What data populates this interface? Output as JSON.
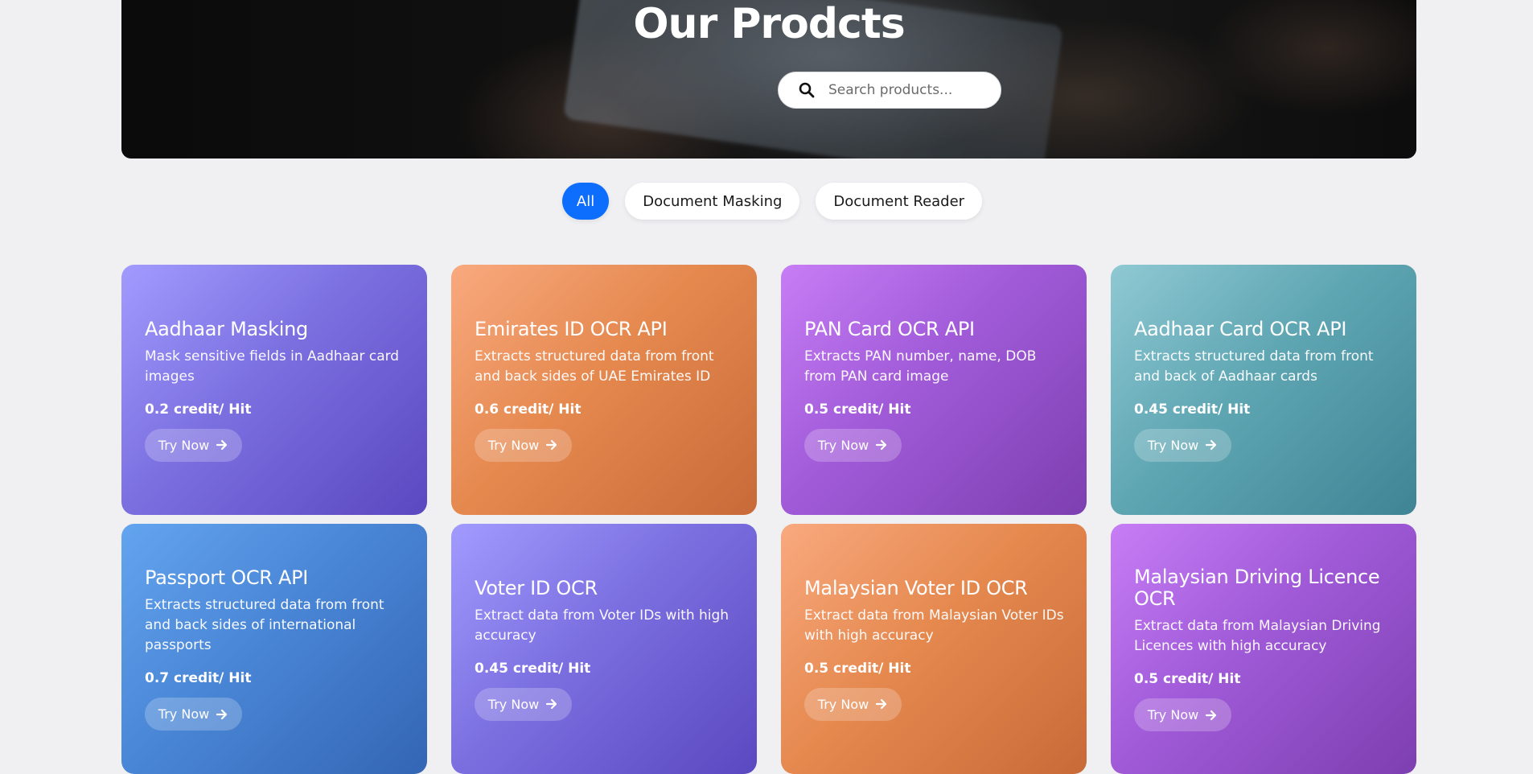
{
  "hero": {
    "title": "Our Prodcts",
    "search_placeholder": "Search products..."
  },
  "filters": [
    {
      "label": "All",
      "active": true
    },
    {
      "label": "Document Masking",
      "active": false
    },
    {
      "label": "Document Reader",
      "active": false
    }
  ],
  "products": [
    {
      "title": "Aadhaar Masking",
      "description": "Mask sensitive fields in Aadhaar card images",
      "price": "0.2 credit/ Hit",
      "cta": "Try Now",
      "gradient": "violet"
    },
    {
      "title": "Emirates ID OCR API",
      "description": "Extracts structured data from front and back sides of UAE Emirates ID",
      "price": "0.6 credit/ Hit",
      "cta": "Try Now",
      "gradient": "orange"
    },
    {
      "title": "PAN Card OCR API",
      "description": "Extracts PAN number, name, DOB from PAN card image",
      "price": "0.5 credit/ Hit",
      "cta": "Try Now",
      "gradient": "purple"
    },
    {
      "title": "Aadhaar Card OCR API",
      "description": "Extracts structured data from front and back of Aadhaar cards",
      "price": "0.45 credit/ Hit",
      "cta": "Try Now",
      "gradient": "teal"
    },
    {
      "title": "Passport OCR API",
      "description": "Extracts structured data from front and back sides of international passports",
      "price": "0.7 credit/ Hit",
      "cta": "Try Now",
      "gradient": "blue"
    },
    {
      "title": "Voter ID OCR",
      "description": "Extract data from Voter IDs with high accuracy",
      "price": "0.45 credit/ Hit",
      "cta": "Try Now",
      "gradient": "violet"
    },
    {
      "title": "Malaysian Voter ID OCR",
      "description": "Extract data from Malaysian Voter IDs with high accuracy",
      "price": "0.5 credit/ Hit",
      "cta": "Try Now",
      "gradient": "orange"
    },
    {
      "title": "Malaysian Driving Licence OCR",
      "description": "Extract data from Malaysian Driving Licences with high accuracy",
      "price": "0.5 credit/ Hit",
      "cta": "Try Now",
      "gradient": "purple"
    }
  ],
  "colors": {
    "accent": "#0d6efd",
    "background": "#f0f0f3"
  },
  "icons": {
    "search": "search-icon",
    "arrow": "arrow-right-icon"
  }
}
